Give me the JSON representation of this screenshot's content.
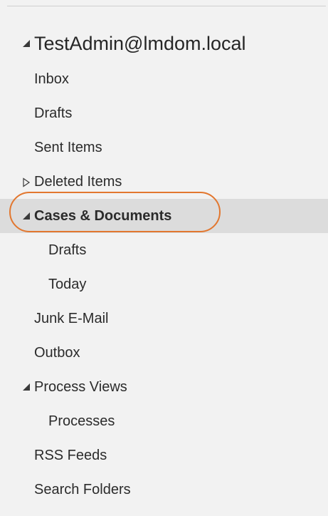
{
  "folder_pane": {
    "account": {
      "label": "TestAdmin@lmdom.local",
      "expanded": true,
      "toggle_icon": "expanded-triangle-icon"
    },
    "folders": [
      {
        "label": "Inbox",
        "level": 0,
        "expander": "none",
        "selected": false
      },
      {
        "label": "Drafts",
        "level": 0,
        "expander": "none",
        "selected": false
      },
      {
        "label": "Sent Items",
        "level": 0,
        "expander": "none",
        "selected": false
      },
      {
        "label": "Deleted Items",
        "level": 0,
        "expander": "collapsed",
        "selected": false
      },
      {
        "label": "Cases & Documents",
        "level": 0,
        "expander": "expanded",
        "selected": true,
        "highlighted": true
      },
      {
        "label": "Drafts",
        "level": 1,
        "expander": "none",
        "selected": false
      },
      {
        "label": "Today",
        "level": 1,
        "expander": "none",
        "selected": false
      },
      {
        "label": "Junk E-Mail",
        "level": 0,
        "expander": "none",
        "selected": false
      },
      {
        "label": "Outbox",
        "level": 0,
        "expander": "none",
        "selected": false
      },
      {
        "label": "Process Views",
        "level": 0,
        "expander": "expanded",
        "selected": false
      },
      {
        "label": "Processes",
        "level": 1,
        "expander": "none",
        "selected": false
      },
      {
        "label": "RSS Feeds",
        "level": 0,
        "expander": "none",
        "selected": false
      },
      {
        "label": "Search Folders",
        "level": 0,
        "expander": "none",
        "selected": false
      }
    ]
  },
  "colors": {
    "pane_background": "#f2f2f2",
    "selected_background": "#dcdcdc",
    "highlight_ring": "#e2772f",
    "text": "#262626"
  }
}
